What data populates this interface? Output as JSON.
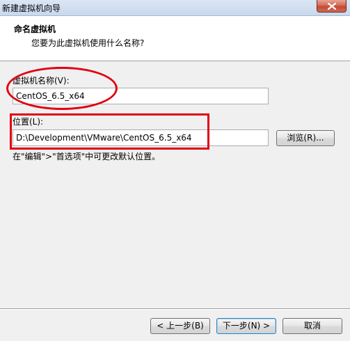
{
  "window": {
    "title": "新建虚拟机向导"
  },
  "header": {
    "title": "命名虚拟机",
    "subtitle": "您要为此虚拟机使用什么名称?"
  },
  "name_field": {
    "label": "虚拟机名称(V):",
    "value": "CentOS_6.5_x64"
  },
  "location_field": {
    "label": "位置(L):",
    "value": "D:\\Development\\VMware\\CentOS_6.5_x64",
    "browse_label": "浏览(R)..."
  },
  "hint": "在\"编辑\">\"首选项\"中可更改默认位置。",
  "footer": {
    "back_label": "< 上一步(B)",
    "next_label": "下一步(N) >",
    "cancel_label": "取消"
  },
  "colors": {
    "annotation": "#e10011",
    "close_button": "#c44a32",
    "header_bg": "#ffffff"
  }
}
